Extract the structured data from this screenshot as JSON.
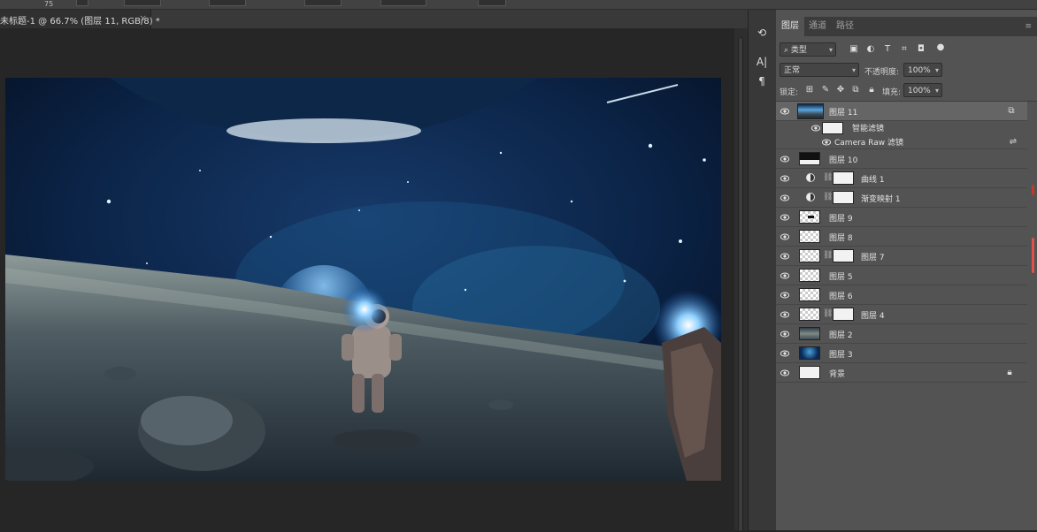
{
  "options_bar": {
    "size_value": "75"
  },
  "document": {
    "tab_title": "未标题-1 @ 66.7% (图层 11, RGB/8) *",
    "close_glyph": "×"
  },
  "toolstrip": {
    "icons": [
      "history-icon",
      "character-icon",
      "paragraph-icon"
    ],
    "history_glyph": "⟲",
    "character_glyph": "A|",
    "paragraph_glyph": "¶"
  },
  "panel": {
    "tabs": [
      {
        "label": "图层",
        "active": true
      },
      {
        "label": "通道",
        "active": false
      },
      {
        "label": "路径",
        "active": false
      }
    ],
    "menu_glyph": "≡",
    "filter": {
      "kind_label": "类型",
      "icons": [
        "pixel-filter-icon",
        "adjustment-filter-icon",
        "type-filter-icon",
        "shape-filter-icon",
        "smart-object-filter-icon",
        "filter-toggle-icon"
      ]
    },
    "blend_mode": "正常",
    "opacity_label": "不透明度:",
    "opacity_value": "100%",
    "lock_label": "锁定:",
    "lock_icons": [
      "lock-transparent-icon",
      "lock-image-icon",
      "lock-position-icon",
      "lock-artboard-icon",
      "lock-all-icon"
    ],
    "fill_label": "填充:",
    "fill_value": "100%"
  },
  "layers": [
    {
      "name": "图层 11",
      "type": "smart",
      "selected": true,
      "visible": true
    },
    {
      "name": "智能滤镜",
      "type": "smart-filter-header",
      "visible": true
    },
    {
      "name": "Camera Raw 滤镜",
      "type": "filter",
      "visible": true
    },
    {
      "name": "图层 10",
      "type": "pixel",
      "visible": true
    },
    {
      "name": "曲线 1",
      "type": "adjustment",
      "visible": true
    },
    {
      "name": "渐变映射 1",
      "type": "adjustment",
      "visible": true
    },
    {
      "name": "图层 9",
      "type": "pixel",
      "visible": true
    },
    {
      "name": "图层 8",
      "type": "pixel",
      "visible": true
    },
    {
      "name": "图层 7",
      "type": "masked",
      "visible": true
    },
    {
      "name": "图层 5",
      "type": "pixel",
      "visible": true
    },
    {
      "name": "图层 6",
      "type": "pixel",
      "visible": true
    },
    {
      "name": "图层 4",
      "type": "masked",
      "visible": true
    },
    {
      "name": "图层 2",
      "type": "pixel",
      "visible": true
    },
    {
      "name": "图层 3",
      "type": "pixel",
      "visible": true
    },
    {
      "name": "背景",
      "type": "background",
      "visible": true,
      "locked": true
    }
  ],
  "colors": {
    "workspace": "#262626",
    "panel": "#535353",
    "selected_layer": "#656565",
    "scroll_marker": "#e0524b"
  }
}
